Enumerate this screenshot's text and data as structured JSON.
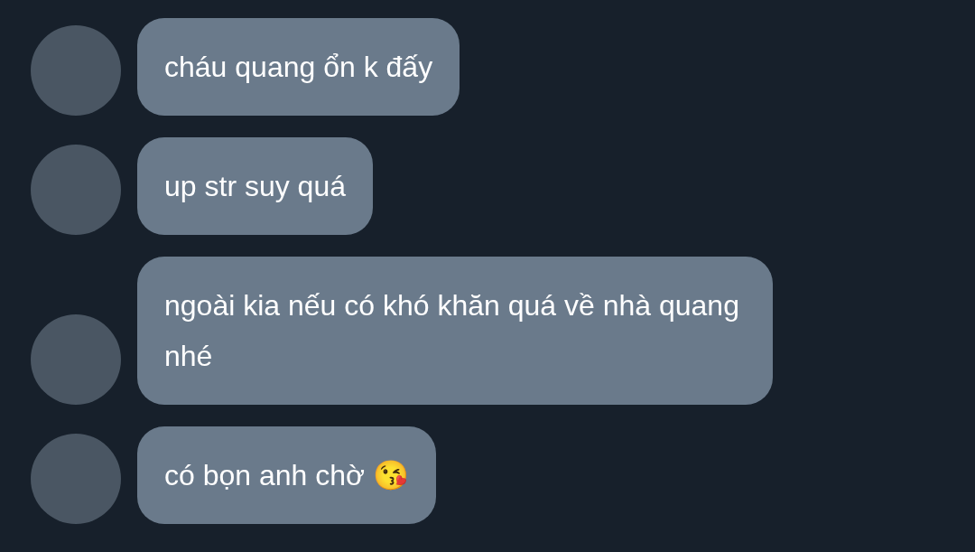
{
  "messages": [
    {
      "text": "cháu quang ổn k đấy"
    },
    {
      "text": "up str suy quá"
    },
    {
      "text": "ngoài kia nếu có khó khăn quá về nhà quang nhé"
    },
    {
      "text": "có bọn anh chờ 😘"
    }
  ]
}
